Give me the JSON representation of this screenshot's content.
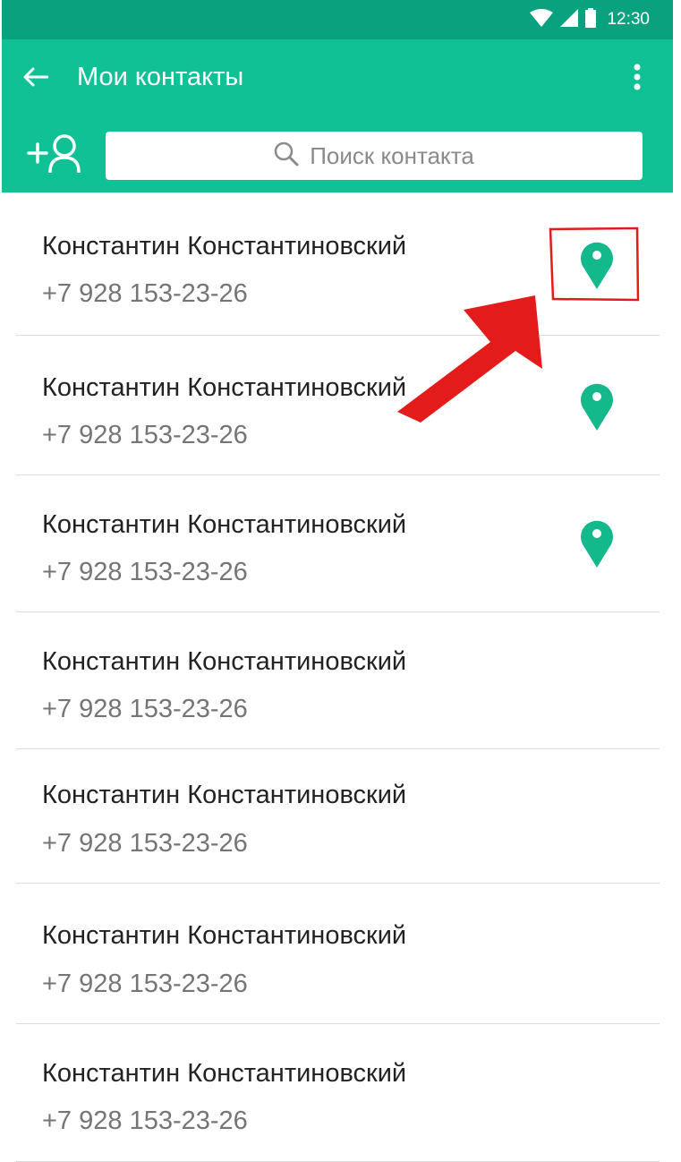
{
  "status_bar": {
    "time": "12:30",
    "icons": [
      "wifi-icon",
      "cell-signal-icon",
      "battery-icon"
    ]
  },
  "app_bar": {
    "title": "Мои контакты",
    "back_icon": "arrow-left-icon",
    "menu_icon": "more-vertical-icon"
  },
  "search": {
    "placeholder": "Поиск контакта",
    "add_icon": "add-user-icon",
    "search_icon": "search-icon"
  },
  "contacts": [
    {
      "name": "Константин Константиновский",
      "phone": "+7 928 153-23-26",
      "has_location": true,
      "highlighted": true
    },
    {
      "name": "Константин Константиновский",
      "phone": "+7 928 153-23-26",
      "has_location": true
    },
    {
      "name": "Константин Константиновский",
      "phone": "+7 928 153-23-26",
      "has_location": true
    },
    {
      "name": "Константин Константиновский",
      "phone": "+7 928 153-23-26",
      "has_location": false
    },
    {
      "name": "Константин Константиновский",
      "phone": "+7 928 153-23-26",
      "has_location": false
    },
    {
      "name": "Константин Константиновский",
      "phone": "+7 928 153-23-26",
      "has_location": false
    },
    {
      "name": "Константин Константиновский",
      "phone": "+7 928 153-23-26",
      "has_location": false
    }
  ],
  "colors": {
    "status_bar": "#0aa27e",
    "app_bar": "#10c195",
    "location_pin": "#13b98a",
    "annotation": "#e31b1b"
  }
}
